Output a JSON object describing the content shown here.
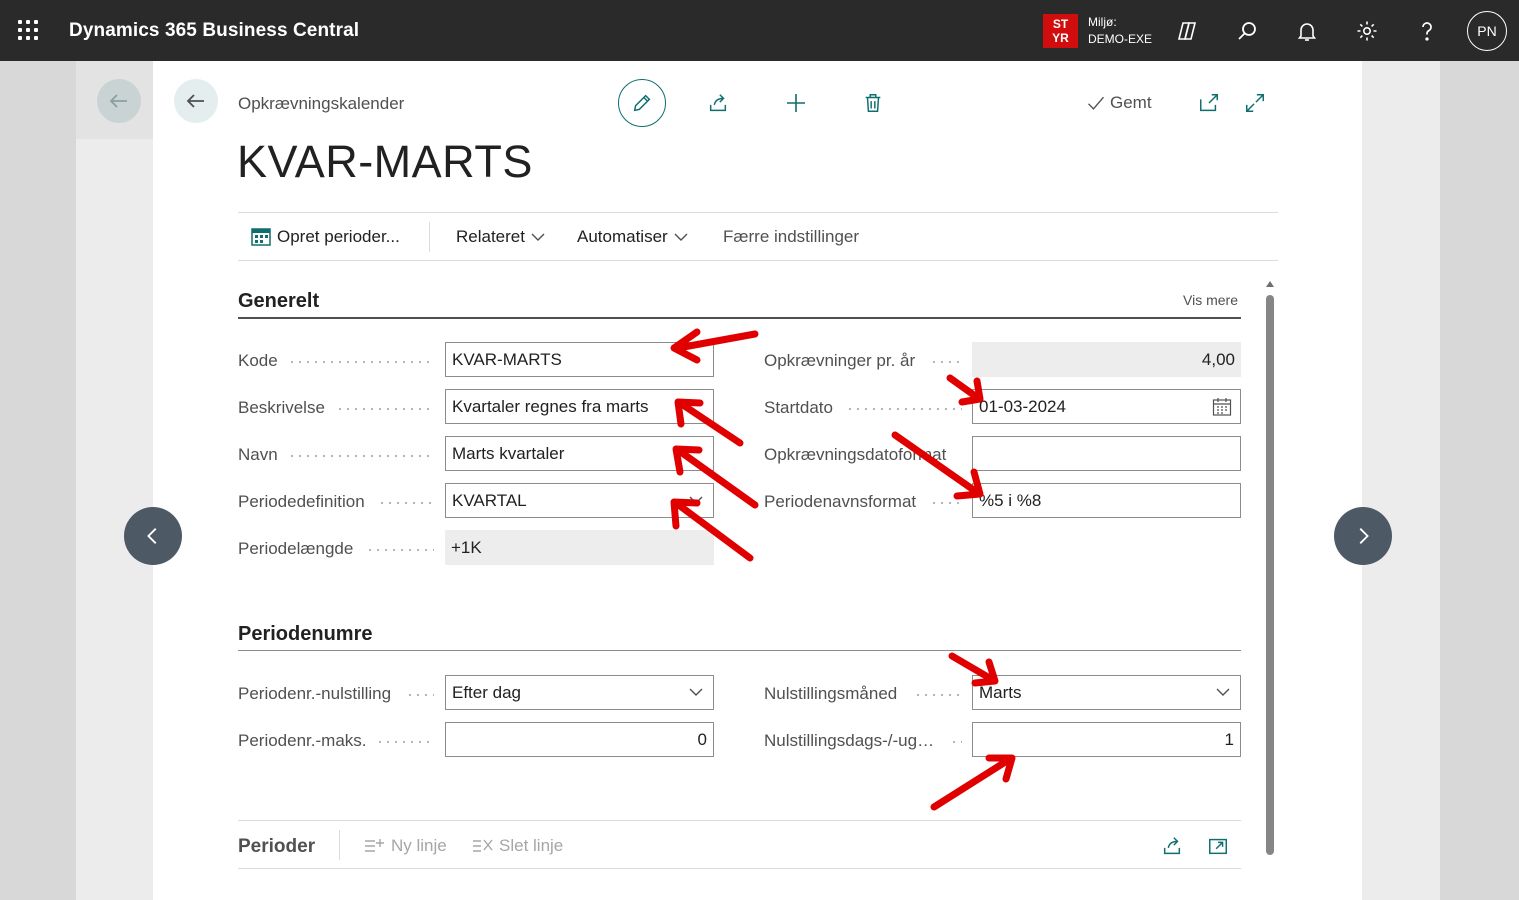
{
  "topbar": {
    "app_title": "Dynamics 365 Business Central",
    "env_badge_line1": "ST",
    "env_badge_line2": "YR",
    "env_label": "Miljø:",
    "env_name": "DEMO-EXE",
    "avatar_initials": "PN",
    "icons": [
      "copilot-icon",
      "search-icon",
      "bell-icon",
      "gear-icon",
      "help-icon"
    ]
  },
  "header": {
    "breadcrumb": "Opkrævningskalender",
    "title": "KVAR-MARTS",
    "saved_label": "Gemt"
  },
  "actionbar": {
    "create_periods": "Opret perioder...",
    "related": "Relateret",
    "automate": "Automatiser",
    "fewer_options": "Færre indstillinger"
  },
  "general": {
    "title": "Generelt",
    "show_more": "Vis mere",
    "left": [
      {
        "label": "Kode",
        "value": "KVAR-MARTS"
      },
      {
        "label": "Beskrivelse",
        "value": "Kvartaler regnes fra marts"
      },
      {
        "label": "Navn",
        "value": "Marts kvartaler"
      },
      {
        "label": "Periodedefinition",
        "value": "KVARTAL"
      },
      {
        "label": "Periodelængde",
        "value": "+1K"
      }
    ],
    "right": [
      {
        "label": "Opkrævninger pr. år",
        "value": "4,00"
      },
      {
        "label": "Startdato",
        "value": "01-03-2024"
      },
      {
        "label": "Opkrævningsdatoformat",
        "value": ""
      },
      {
        "label": "Periodenavnsformat",
        "value": "%5 i %8"
      }
    ]
  },
  "period_numbers": {
    "title": "Periodenumre",
    "left": [
      {
        "label": "Periodenr.-nulstilling",
        "value": "Efter dag"
      },
      {
        "label": "Periodenr.-maks.",
        "value": "0"
      }
    ],
    "right": [
      {
        "label": "Nulstillingsmåned",
        "value": "Marts"
      },
      {
        "label": "Nulstillingsdags-/-uge-nr.",
        "value": "1"
      }
    ]
  },
  "periods_part": {
    "title": "Perioder",
    "new_line": "Ny linje",
    "delete_line": "Slet linje"
  },
  "colors": {
    "topbar": "#2a2a2a",
    "accent": "#0f6e6e",
    "env_badge": "#d10d0d",
    "annotation_arrow": "#e00000"
  }
}
